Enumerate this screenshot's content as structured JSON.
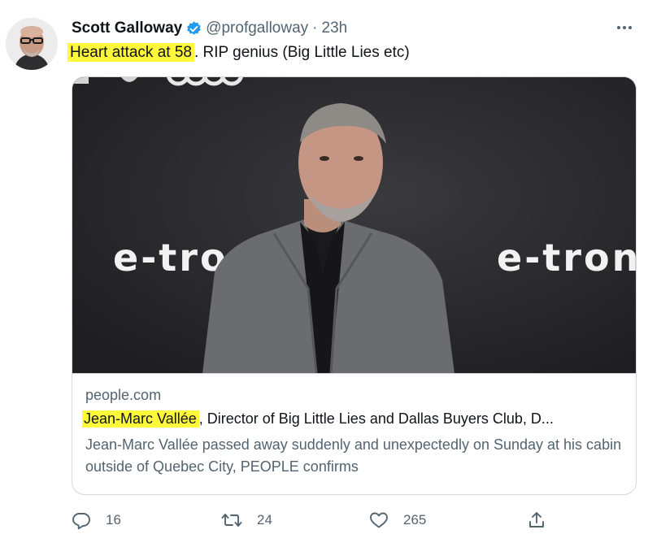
{
  "tweet": {
    "author_name": "Scott Galloway",
    "handle": "@profgalloway",
    "separator": "·",
    "time": "23h",
    "text_highlight": "Heart attack at 58",
    "text_rest": ". RIP genius (Big Little Lies etc)"
  },
  "card": {
    "domain": "people.com",
    "title_highlight": "Jean-Marc Vallée",
    "title_rest": ", Director of Big Little Lies and Dallas Buyers Club, D...",
    "description": "Jean-Marc Vallée passed away suddenly and unexpectedly on Sunday at his cabin outside of Quebec City, PEOPLE confirms",
    "image_backdrop_text": "e-tron"
  },
  "actions": {
    "reply_count": "16",
    "retweet_count": "24",
    "like_count": "265"
  },
  "colors": {
    "highlight": "#fff83b",
    "verified_blue": "#1d9bf0",
    "secondary_text": "#536471",
    "primary_text": "#0f1419",
    "border": "#cfd9de"
  },
  "icons": [
    "more-icon",
    "verified-badge-icon",
    "reply-icon",
    "retweet-icon",
    "like-icon",
    "share-icon"
  ]
}
